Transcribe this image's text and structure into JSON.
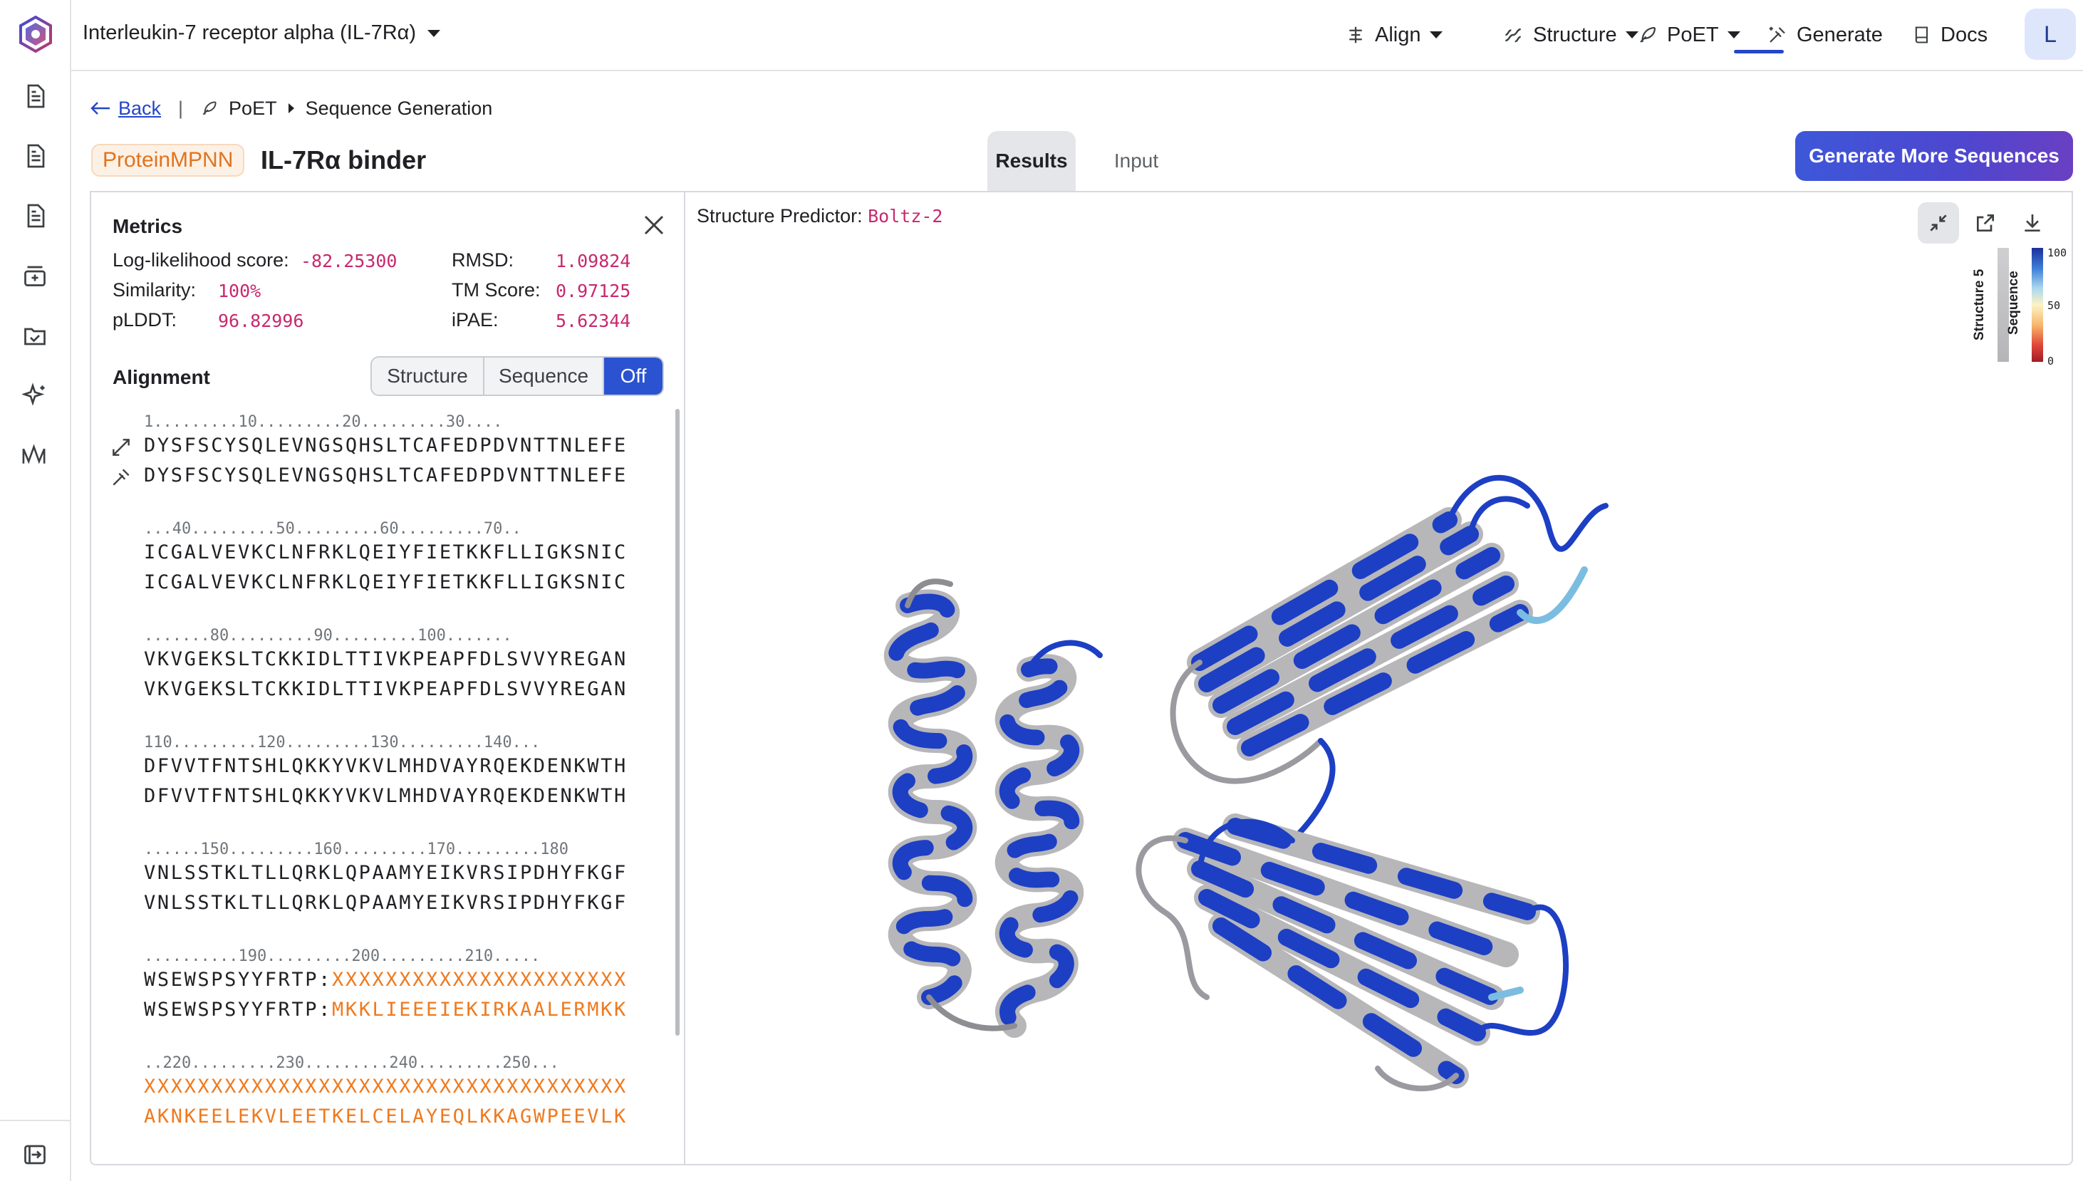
{
  "topbar": {
    "project_title": "Interleukin-7 receptor alpha (IL-7Rα)",
    "nav": {
      "align": "Align",
      "structure": "Structure",
      "poet": "PoET",
      "generate": "Generate",
      "docs": "Docs"
    },
    "avatar_letter": "L"
  },
  "breadcrumb": {
    "back": "Back",
    "section": "PoET",
    "page": "Sequence Generation"
  },
  "header": {
    "model_badge": "ProteinMPNN",
    "title": "IL-7Rα binder",
    "tabs": {
      "results": "Results",
      "input": "Input"
    },
    "generate_more": "Generate More Sequences"
  },
  "metrics": {
    "title": "Metrics",
    "left": [
      {
        "label": "Log-likelihood score:",
        "value": "-82.25300"
      },
      {
        "label": "Similarity:",
        "value": "100%"
      },
      {
        "label": "pLDDT:",
        "value": "96.82996"
      }
    ],
    "right": [
      {
        "label": "RMSD:",
        "value": "1.09824"
      },
      {
        "label": "TM Score:",
        "value": "0.97125"
      },
      {
        "label": "iPAE:",
        "value": "5.62344"
      }
    ]
  },
  "alignment": {
    "title": "Alignment",
    "modes": [
      "Structure",
      "Sequence",
      "Off"
    ],
    "active_mode": "Off",
    "blocks": [
      {
        "ruler": "1.........10.........20.........30....",
        "top": "DYSFSCYSQLEVNGSQHSLTCAFEDPDVNTTNLEFE",
        "bottom": "DYSFSCYSQLEVNGSQHSLTCAFEDPDVNTTNLEFE",
        "top_x": "",
        "bottom_x": ""
      },
      {
        "ruler": "...40.........50.........60.........70..",
        "top": "ICGALVEVKCLNFRKLQEIYFIETKKFLLIGKSNIC",
        "bottom": "ICGALVEVKCLNFRKLQEIYFIETKKFLLIGKSNIC",
        "top_x": "",
        "bottom_x": ""
      },
      {
        "ruler": ".......80.........90.........100.......",
        "top": "VKVGEKSLTCKKIDLTTIVKPEAPFDLSVVYREGAN",
        "bottom": "VKVGEKSLTCKKIDLTTIVKPEAPFDLSVVYREGAN",
        "top_x": "",
        "bottom_x": ""
      },
      {
        "ruler": "110.........120.........130.........140...",
        "top": "DFVVTFNTSHLQKKYVKVLMHDVAYRQEKDENKWTH",
        "bottom": "DFVVTFNTSHLQKKYVKVLMHDVAYRQEKDENKWTH",
        "top_x": "",
        "bottom_x": ""
      },
      {
        "ruler": "......150.........160.........170.........180",
        "top": "VNLSSTKLTLLQRKLQPAAMYEIKVRSIPDHYFKGF",
        "bottom": "VNLSSTKLTLLQRKLQPAAMYEIKVRSIPDHYFKGF",
        "top_x": "",
        "bottom_x": ""
      },
      {
        "ruler": "..........190.........200.........210.....",
        "top": "WSEWSPSYYFRTP:",
        "bottom": "WSEWSPSYYFRTP:",
        "top_x": "XXXXXXXXXXXXXXXXXXXXXX",
        "bottom_x": "MKKLIEEEIEKIRKAALERMKK"
      },
      {
        "ruler": "..220.........230.........240.........250...",
        "top": "",
        "bottom": "",
        "top_x": "XXXXXXXXXXXXXXXXXXXXXXXXXXXXXXXXXXXX",
        "bottom_x": "AKNKEELEKVLEETKELCELAYEQLKKAGWPEEVLK"
      }
    ]
  },
  "viewer": {
    "predictor_label": "Structure Predictor:",
    "predictor_value": "Boltz-2",
    "legend": {
      "structure_label": "Structure 5",
      "sequence_label": "Sequence",
      "scale": [
        "100",
        "50",
        "0"
      ]
    }
  },
  "colors": {
    "accent": "#2b53d1",
    "metric_value": "#c8286e",
    "designed_residue": "#ef7a1f",
    "badge_text": "#e0731f",
    "ribbon_blue": "#1d3fc4",
    "ribbon_gray": "#b8b8ba"
  }
}
